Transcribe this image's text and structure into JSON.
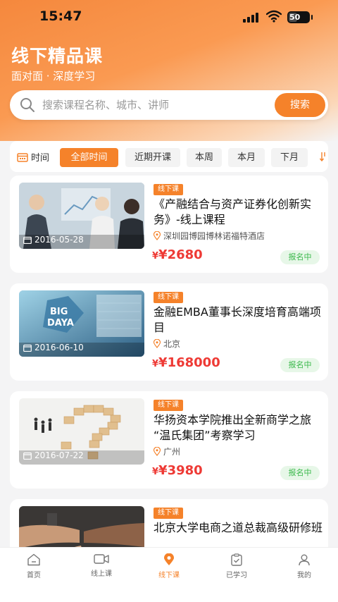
{
  "status_bar": {
    "time": "15:47",
    "battery": "50"
  },
  "header": {
    "title": "线下精品课",
    "subtitle": "面对面 · 深度学习"
  },
  "search": {
    "placeholder": "搜索课程名称、城市、讲师",
    "button_label": "搜索"
  },
  "filter": {
    "label": "时间",
    "chips": [
      "全部时间",
      "近期开课",
      "本周",
      "本月",
      "下月"
    ],
    "active_index": 0
  },
  "courses": [
    {
      "tag": "线下课",
      "title": "《产融结合与资产证券化创新实务》-线上课程",
      "location": "深圳园博园博林诺福特酒店",
      "currency": "¥",
      "price": "¥2680",
      "date": "2016-05-28",
      "status": "报名中",
      "image": "business-meeting-photo"
    },
    {
      "tag": "线下课",
      "title": "金融EMBA董事长深度培育高端项目",
      "location": "北京",
      "currency": "¥",
      "price": "¥168000",
      "date": "2016-06-10",
      "status": "报名中",
      "image": "big-data-screen-photo"
    },
    {
      "tag": "线下课",
      "title": "华扬资本学院推出全新商学之旅 “温氏集团”考察学习",
      "location": "广州",
      "currency": "¥",
      "price": "¥3980",
      "date": "2016-07-22",
      "status": "报名中",
      "image": "wooden-blocks-question-mark-photo"
    },
    {
      "tag": "线下课",
      "title": "北京大学电商之道总裁高级研修班",
      "location": "",
      "currency": "",
      "price": "",
      "date": "",
      "status": "",
      "image": "fist-bump-team-photo"
    }
  ],
  "tabbar": {
    "items": [
      {
        "label": "首页",
        "icon": "home-icon"
      },
      {
        "label": "线上课",
        "icon": "video-icon"
      },
      {
        "label": "线下课",
        "icon": "location-pin-icon"
      },
      {
        "label": "已学习",
        "icon": "clipboard-check-icon"
      },
      {
        "label": "我的",
        "icon": "user-icon"
      }
    ],
    "active_index": 2
  },
  "colors": {
    "accent": "#f5822a",
    "price": "#ee3a35",
    "status_green": "#39b84a"
  }
}
